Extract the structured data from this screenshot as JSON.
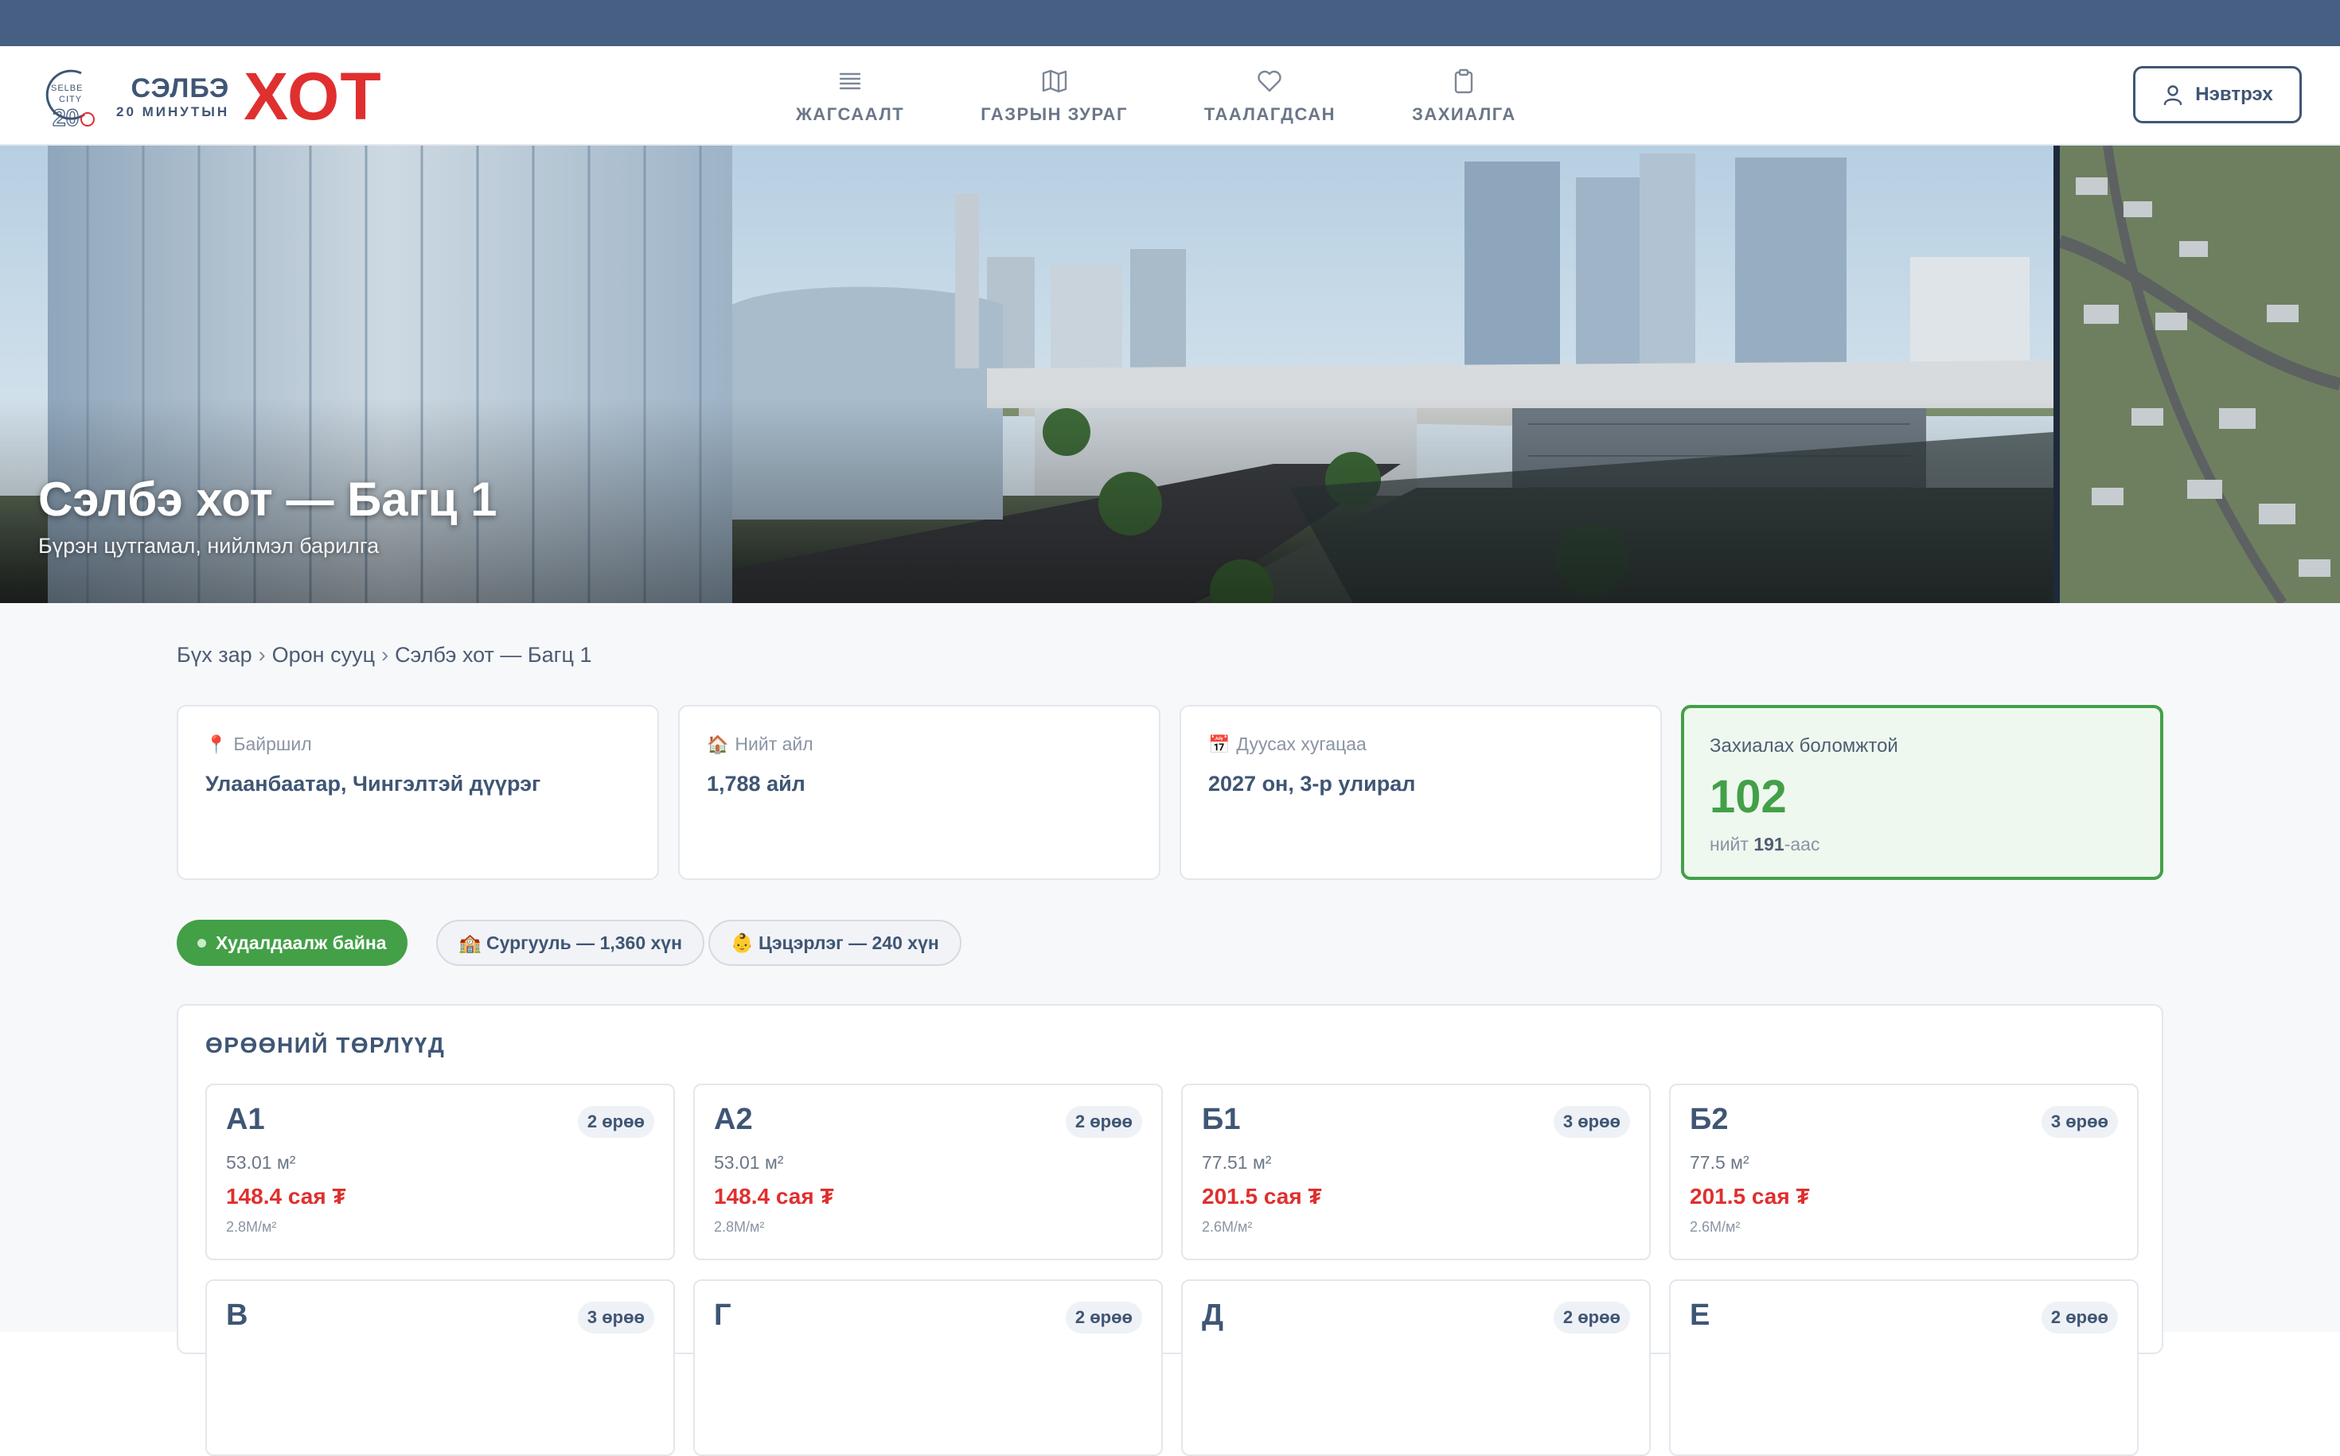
{
  "brand": {
    "emblem_text": [
      "SELBE",
      "CITY"
    ],
    "name_top": "СЭЛБЭ",
    "name_bottom": "20 МИНУТЫН",
    "name_big": "ХОТ"
  },
  "nav": {
    "items": [
      {
        "label": "ЖАГСААЛТ",
        "icon": "list-icon"
      },
      {
        "label": "ГАЗРЫН ЗУРАГ",
        "icon": "map-icon"
      },
      {
        "label": "ТААЛАГДСАН",
        "icon": "heart-icon"
      },
      {
        "label": "ЗАХИАЛГА",
        "icon": "clipboard-icon"
      }
    ],
    "login_label": "Нэвтрэх"
  },
  "hero": {
    "title": "Сэлбэ хот — Багц 1",
    "subtitle": "Бүрэн цутгамал, нийлмэл барилга"
  },
  "breadcrumb": [
    "Бүх зар",
    "Орон сууц",
    "Сэлбэ хот — Багц 1"
  ],
  "info_cards": [
    {
      "icon": "📍",
      "label": "Байршил",
      "value": "Улаанбаатар, Чингэлтэй дүүрэг"
    },
    {
      "icon": "🏠",
      "label": "Нийт айл",
      "value": "1,788 айл"
    },
    {
      "icon": "📅",
      "label": "Дуусах хугацаа",
      "value": "2027 он, 3-р улирал"
    }
  ],
  "availability": {
    "label": "Захиалах боломжтой",
    "count": "102",
    "total_prefix": "нийт ",
    "total": "191",
    "total_suffix": "-аас"
  },
  "tags": {
    "status": "Худалдаалж байна",
    "school": "🏫 Сургууль — 1,360 хүн",
    "kindergarten": "👶 Цэцэрлэг — 240 хүн"
  },
  "unit_types": {
    "title": "ӨРӨӨНИЙ ТӨРЛҮҮД",
    "items": [
      {
        "name": "А1",
        "rooms": "2 өрөө",
        "area": "53.01 м²",
        "price": "148.4 сая ₮",
        "ppm": "2.8М/м²"
      },
      {
        "name": "А2",
        "rooms": "2 өрөө",
        "area": "53.01 м²",
        "price": "148.4 сая ₮",
        "ppm": "2.8М/м²"
      },
      {
        "name": "Б1",
        "rooms": "3 өрөө",
        "area": "77.51 м²",
        "price": "201.5 сая ₮",
        "ppm": "2.6М/м²"
      },
      {
        "name": "Б2",
        "rooms": "3 өрөө",
        "area": "77.5 м²",
        "price": "201.5 сая ₮",
        "ppm": "2.6М/м²"
      },
      {
        "name": "В",
        "rooms": "3 өрөө"
      },
      {
        "name": "Г",
        "rooms": "2 өрөө"
      },
      {
        "name": "Д",
        "rooms": "2 өрөө"
      },
      {
        "name": "Е",
        "rooms": "2 өрөө"
      }
    ]
  },
  "colors": {
    "topbar": "#465f82",
    "brand_red": "#e02f2f",
    "brand_blue": "#3f5675",
    "available_green": "#43a047"
  }
}
